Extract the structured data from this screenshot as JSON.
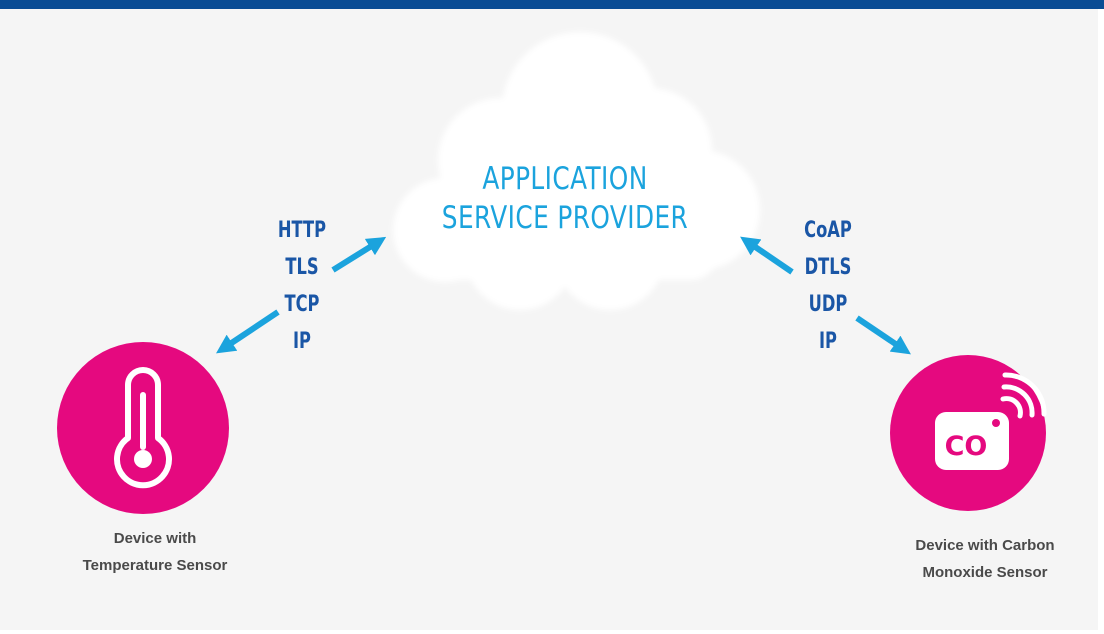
{
  "colors": {
    "header_bar": "#0a4c94",
    "title": "#1ba3dd",
    "protocol_text": "#1a56a6",
    "arrow": "#1ba3dd",
    "device_circle": "#e5097f",
    "label_text": "#4a4a4a"
  },
  "cloud": {
    "title_line1": "APPLICATION",
    "title_line2": "SERVICE PROVIDER"
  },
  "left_protocols": [
    "HTTP",
    "TLS",
    "TCP",
    "IP"
  ],
  "right_protocols": [
    "CoAP",
    "DTLS",
    "UDP",
    "IP"
  ],
  "devices": {
    "left": {
      "icon": "thermometer-icon",
      "label_line1": "Device with",
      "label_line2": "Temperature Sensor"
    },
    "right": {
      "icon": "co-sensor-icon",
      "icon_text": "CO",
      "label_line1": "Device with Carbon",
      "label_line2": "Monoxide Sensor"
    }
  }
}
